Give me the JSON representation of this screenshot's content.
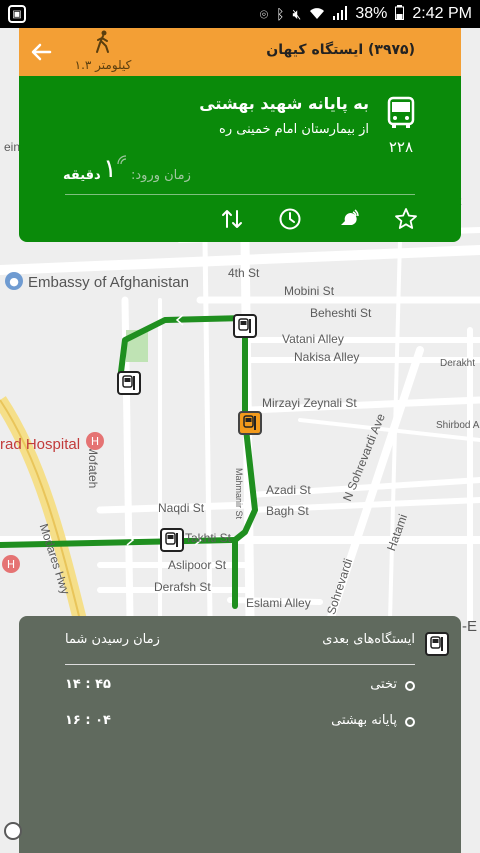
{
  "status_bar": {
    "battery": "38%",
    "time": "2:42 PM",
    "icons": [
      "app-icon",
      "location-icon",
      "bluetooth-icon",
      "mute-icon",
      "wifi-icon",
      "signal-icon",
      "battery-icon"
    ]
  },
  "header": {
    "station_title": "(۳۹۷۵) ایستگاه  کیهان",
    "walk_distance": "۱.۳ کیلومتر",
    "back_icon": "back-arrow-icon",
    "walk_icon": "walking-person-icon"
  },
  "route_card": {
    "destination": "به پایانه شهید بهشتی",
    "origin": "از بیمارستان امام خمینی ره",
    "route_number": "۲۲۸",
    "arrival_label": "زمان ورود:",
    "arrival_value": "۱",
    "arrival_unit": "دقیقه",
    "actions": [
      "swap-direction-icon",
      "clock-icon",
      "notification-icon",
      "star-icon"
    ]
  },
  "map": {
    "labels": {
      "embassy": "Embassy of Afghanistan",
      "hospital": "rad Hospital",
      "st_4th": "4th St",
      "mobini": "Mobini St",
      "beheshti": "Beheshti St",
      "vatani": "Vatani Alley",
      "nakisa": "Nakisa Alley",
      "mirzayi": "Mirzayi Zeynali St",
      "mofateh": "N Mofateh",
      "sohrevardi": "N Sohrevardi Ave",
      "azadi": "Azadi St",
      "bagh": "Bagh St",
      "naqdi": "Naqdi St",
      "takhti": "Takhti St",
      "aslipoor": "Aslipoor St",
      "derafsh": "Derafsh St",
      "eslami": "Eslami Alley",
      "modares": "Modares Hwy",
      "mahmanir": "Mahmanir St",
      "sohrevardi2": "Sohrevardi",
      "hatami": "Hatami",
      "shirbod": "Shirbod Alley",
      "einit": "einì",
      "derakht": "Derakht",
      "east_e": "-E",
      "st_fragment": "St"
    }
  },
  "bottom_panel": {
    "next_stations_label": "ایستگاه‌های بعدی",
    "arrival_time_label": "زمان رسیدن شما",
    "stops": [
      {
        "name": "تختی",
        "time": "۱۴ : ۴۵"
      },
      {
        "name": "پایانه بهشتی",
        "time": "۱۶ : ۰۴"
      }
    ]
  },
  "colors": {
    "header_orange": "#f39f35",
    "card_green": "#0a8a0a",
    "route_green": "#1f8f1f",
    "panel_gray": "#606a5e"
  }
}
